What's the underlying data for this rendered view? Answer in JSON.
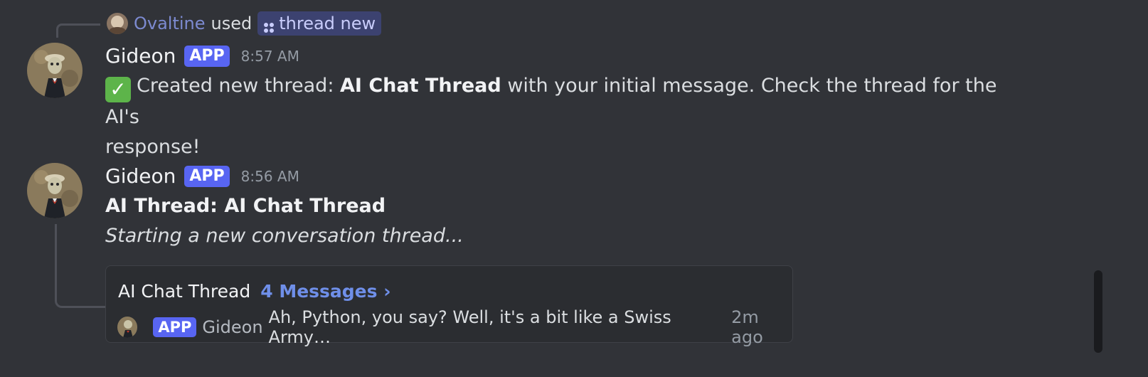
{
  "reply_context": {
    "user": "Ovaltine",
    "used_text": "used",
    "command": "thread new"
  },
  "messages": [
    {
      "author": "Gideon",
      "badge": "APP",
      "time": "8:57 AM",
      "text_prefix": "Created new thread: ",
      "thread_name_bold": "AI Chat Thread",
      "text_suffix_line1": " with your initial message. Check the thread for the AI's",
      "text_line2": "response!"
    },
    {
      "author": "Gideon",
      "badge": "APP",
      "time": "8:56 AM",
      "title": "AI Thread: AI Chat Thread",
      "subtitle": "Starting a new conversation thread...",
      "thread": {
        "name": "AI Chat Thread",
        "count": "4 Messages ›",
        "preview_badge": "APP",
        "preview_author": "Gideon",
        "preview_text": "Ah, Python, you say? Well, it's a bit like a Swiss Army…",
        "preview_time": "2m ago"
      }
    }
  ],
  "colors": {
    "background": "#313338",
    "app_badge": "#5865f2",
    "link_blue": "#6f8fe9",
    "check_green": "#5db44a"
  }
}
